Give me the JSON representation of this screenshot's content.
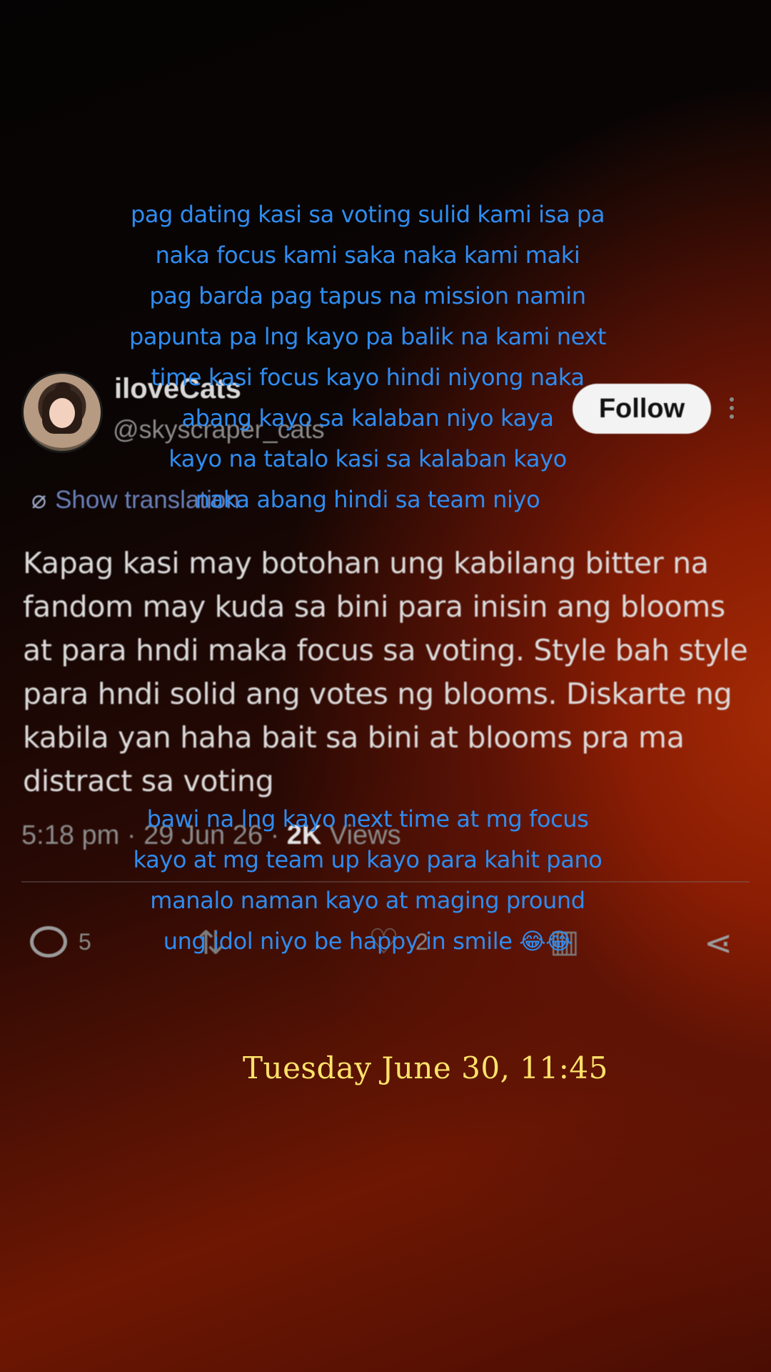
{
  "tweet": {
    "display_name": "iloveCats",
    "handle": "@skyscraper_cats",
    "follow_label": "Follow",
    "translate_label": "Show translation",
    "body": "Kapag kasi may botohan ung kabilang bitter na fandom may kuda sa bini para inisin ang blooms at para hndi maka focus sa voting. Style bah style para hndi solid ang votes ng blooms. Diskarte ng kabila yan haha bait sa bini at blooms pra ma distract sa voting",
    "time": "5:18 pm",
    "date": "29 Jun 26",
    "views_count": "2K",
    "views_label": "Views",
    "reply_count": "5",
    "like_count": "2",
    "icons": {
      "reply": "reply-icon",
      "retweet": "retweet-icon",
      "like": "heart-icon",
      "stats": "stats-icon",
      "share": "share-icon",
      "more": "more-icon",
      "translate": "translate-icon"
    }
  },
  "caption_top": {
    "lines": [
      "pag dating kasi sa voting sulid kami isa pa",
      "naka focus kami saka naka kami maki",
      "pag barda pag tapus na mission namin",
      "papunta pa lng kayo pa balik na kami next",
      "time kasi focus kayo hindi niyong naka",
      "abang kayo sa kalaban niyo kaya",
      "kayo na tatalo kasi sa kalaban kayo",
      "naka abang hindi sa team niyo"
    ]
  },
  "caption_bottom": {
    "lines": [
      "bawi na lng kayo next time at mg focus",
      "kayo at mg team up kayo para kahit pano",
      "manalo naman kayo at maging pround",
      "ung idol niyo be happy in smile 😂😂"
    ]
  },
  "timestamp": "Tuesday June 30, 11:45",
  "colors": {
    "caption": "#2f8cf0",
    "timestamp": "#ffe36a",
    "background_accent": "#a42a05"
  }
}
